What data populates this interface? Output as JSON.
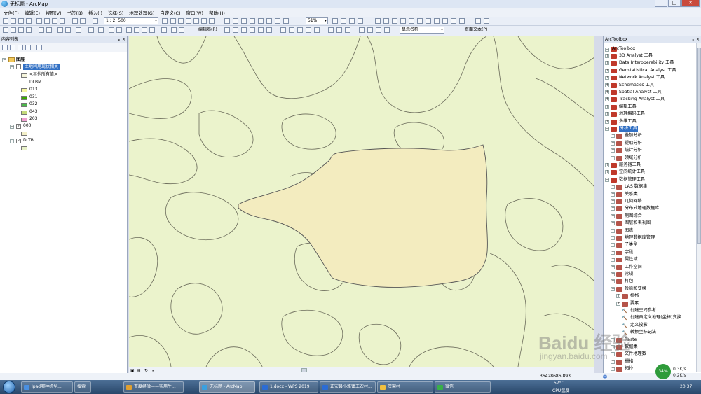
{
  "window": {
    "title": "无标题 - ArcMap",
    "min": "—",
    "max": "□",
    "close": "✕"
  },
  "menu": [
    "文件(F)",
    "编辑(E)",
    "视图(V)",
    "书签(B)",
    "插入(I)",
    "选择(S)",
    "地理处理(G)",
    "自定义(C)",
    "窗口(W)",
    "帮助(H)"
  ],
  "toolbar": {
    "scale": "1 : 2, 500",
    "zoom_pct": "51%",
    "editor_label": "编辑器(R)·",
    "display_field": "显示名称",
    "page_text": "页面文本(P)·"
  },
  "toc": {
    "title": "内容列表",
    "root": "图层",
    "layer1": {
      "name": "土地利用现状相关",
      "other": "<其他所有值>",
      "field": "DLBM",
      "classes": [
        "013",
        "031",
        "032",
        "043",
        "203"
      ],
      "colors": [
        "#f5f5a0",
        "#38a800",
        "#4cb84c",
        "#c4d97a",
        "#f0a0d0"
      ]
    },
    "layer2": {
      "name": "000"
    },
    "layer3": {
      "name": "DLTB"
    }
  },
  "arctoolbox": {
    "title": "ArcToolbox",
    "root": "ArcToolbox",
    "items": [
      "3D Analyst 工具",
      "Data Interoperability 工具",
      "Geostatistical Analyst 工具",
      "Network Analyst 工具",
      "Schematics 工具",
      "Spatial Analyst 工具",
      "Tracking Analyst 工具",
      "编辑工具",
      "地理编码工具",
      "多维工具",
      "分析工具"
    ],
    "analysis_children": [
      "叠加分析",
      "提取分析",
      "统计分析",
      "领域分析"
    ],
    "items2": [
      "服务器工具",
      "空间统计工具",
      "数据管理工具"
    ],
    "dm_children": [
      "LAS 数据集",
      "关系类",
      "几何网络",
      "分布式地理数据库",
      "制图综合",
      "图层和表视图",
      "图表",
      "地理数据库管理",
      "子类型",
      "字段",
      "属性域",
      "工作空间",
      "常规",
      "打包",
      "投影和变换"
    ],
    "proj_children": [
      "栅格",
      "要素",
      "创建空间参考",
      "创建自定义地理(坐标)变换",
      "定义投影",
      "转换坐标记法"
    ],
    "tail": [
      "Raste",
      "数据集",
      "文件地理数",
      "栅格",
      "拓扑"
    ]
  },
  "status": {
    "coords": "36428686.893"
  },
  "taskbar": {
    "items": [
      "Ipad哪种机型...",
      "搜索",
      "百度经验——实用生...",
      "无标题 - ArcMap",
      "1.docx - WPS 2019",
      "正安县小雅镇工农村...",
      "茨梨村",
      "微信"
    ],
    "tray_temp": "57°C",
    "tray_cpu": "CPU温度",
    "net_up": "0.3K/s",
    "net_down": "0.2K/s",
    "net_pct": "34%",
    "time": "20:37"
  },
  "watermark": {
    "brand": "Baidu 经验",
    "url": "jingyan.baidu.com"
  }
}
